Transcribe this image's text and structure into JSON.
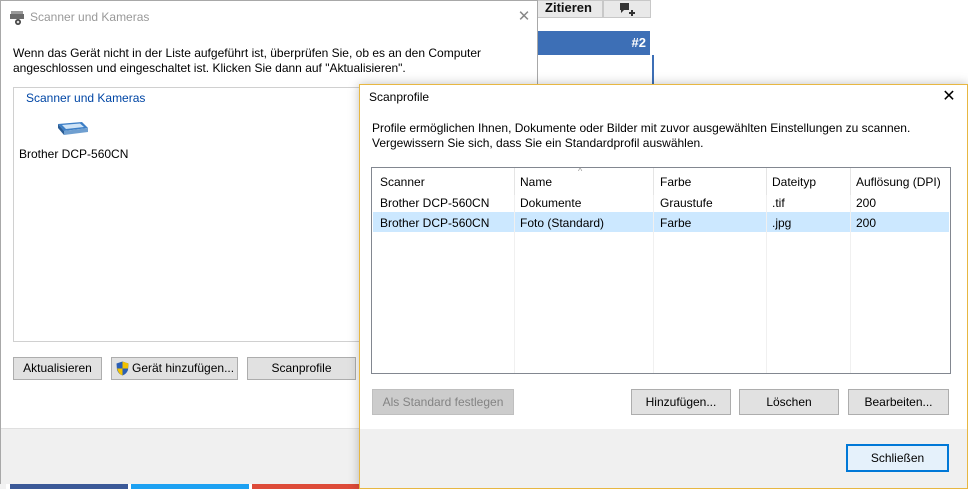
{
  "background": {
    "cite_button": "Zitieren",
    "post_number": "#2"
  },
  "scanner_dialog": {
    "title": "Scanner und Kameras",
    "close_glyph": "✕",
    "instructions": "Wenn das Gerät nicht in der Liste aufgeführt ist, überprüfen Sie, ob es an den Computer angeschlossen und eingeschaltet ist. Klicken Sie dann auf \"Aktualisieren\".",
    "group_label": "Scanner und Kameras",
    "devices": [
      {
        "name": "Brother DCP-560CN",
        "icon": "scanner-icon"
      }
    ],
    "buttons": {
      "refresh": "Aktualisieren",
      "add_device": "Gerät hinzufügen...",
      "scan_profiles": "Scanprofile"
    }
  },
  "profiles_dialog": {
    "title": "Scanprofile",
    "close_glyph": "✕",
    "description": "Profile ermöglichen Ihnen, Dokumente oder Bilder mit zuvor ausgewählten Einstellungen zu scannen. Vergewissern Sie sich, dass Sie ein Standardprofil auswählen.",
    "columns": [
      "Scanner",
      "Name",
      "Farbe",
      "Dateityp",
      "Auflösung (DPI)"
    ],
    "sort_indicator": "^",
    "rows": [
      {
        "scanner": "Brother DCP-560CN",
        "name": "Dokumente",
        "color": "Graustufe",
        "filetype": ".tif",
        "dpi": "200",
        "selected": false
      },
      {
        "scanner": "Brother DCP-560CN",
        "name": "Foto (Standard)",
        "color": "Farbe",
        "filetype": ".jpg",
        "dpi": "200",
        "selected": true
      }
    ],
    "buttons": {
      "set_default": "Als Standard festlegen",
      "add": "Hinzufügen...",
      "delete": "Löschen",
      "edit": "Bearbeiten...",
      "close": "Schließen"
    }
  },
  "colors": {
    "selection": "#cce8ff",
    "accent": "#0078d7",
    "group_label": "#0046a5",
    "forum_bar": "#3d6fb6"
  }
}
